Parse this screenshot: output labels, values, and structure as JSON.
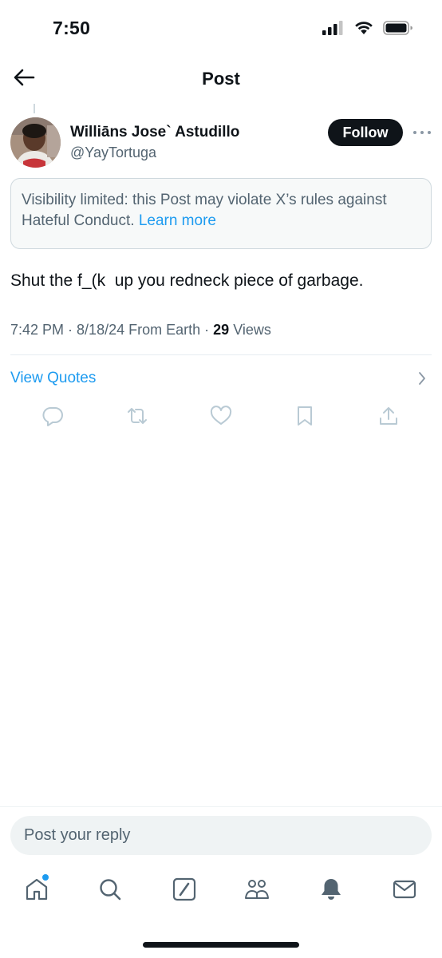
{
  "status_bar": {
    "time": "7:50",
    "icons": [
      "cellular-signal-icon",
      "wifi-icon",
      "battery-icon"
    ]
  },
  "header": {
    "title": "Post",
    "back_icon": "arrow-left-icon"
  },
  "post": {
    "author": {
      "name": "Williāns Jose` Astudillo",
      "handle": "@YayTortuga",
      "avatar_icon": "profile-photo"
    },
    "follow_label": "Follow",
    "more_icon": "more-dots-icon",
    "notice": {
      "text": "Visibility limited: this Post may violate X’s rules against Hateful Conduct. ",
      "link": "Learn more"
    },
    "text": "Shut the f_(k  up you redneck piece of garbage.",
    "meta": {
      "time": "7:42 PM",
      "separator": " · ",
      "date": "8/18/24",
      "source": "From Earth",
      "views_count": "29",
      "views_label": "Views"
    },
    "view_quotes": "View Quotes",
    "actions": [
      "reply-icon",
      "repost-icon",
      "like-icon",
      "bookmark-icon",
      "share-icon"
    ]
  },
  "reply": {
    "placeholder": "Post your reply"
  },
  "tab_bar": {
    "items": [
      "home-icon",
      "search-icon",
      "grok-icon",
      "communities-icon",
      "notifications-icon",
      "messages-icon"
    ]
  },
  "colors": {
    "accent": "#1d9bf0",
    "text": "#0f1419",
    "secondary": "#536471",
    "icon_muted": "#b9cad4"
  }
}
